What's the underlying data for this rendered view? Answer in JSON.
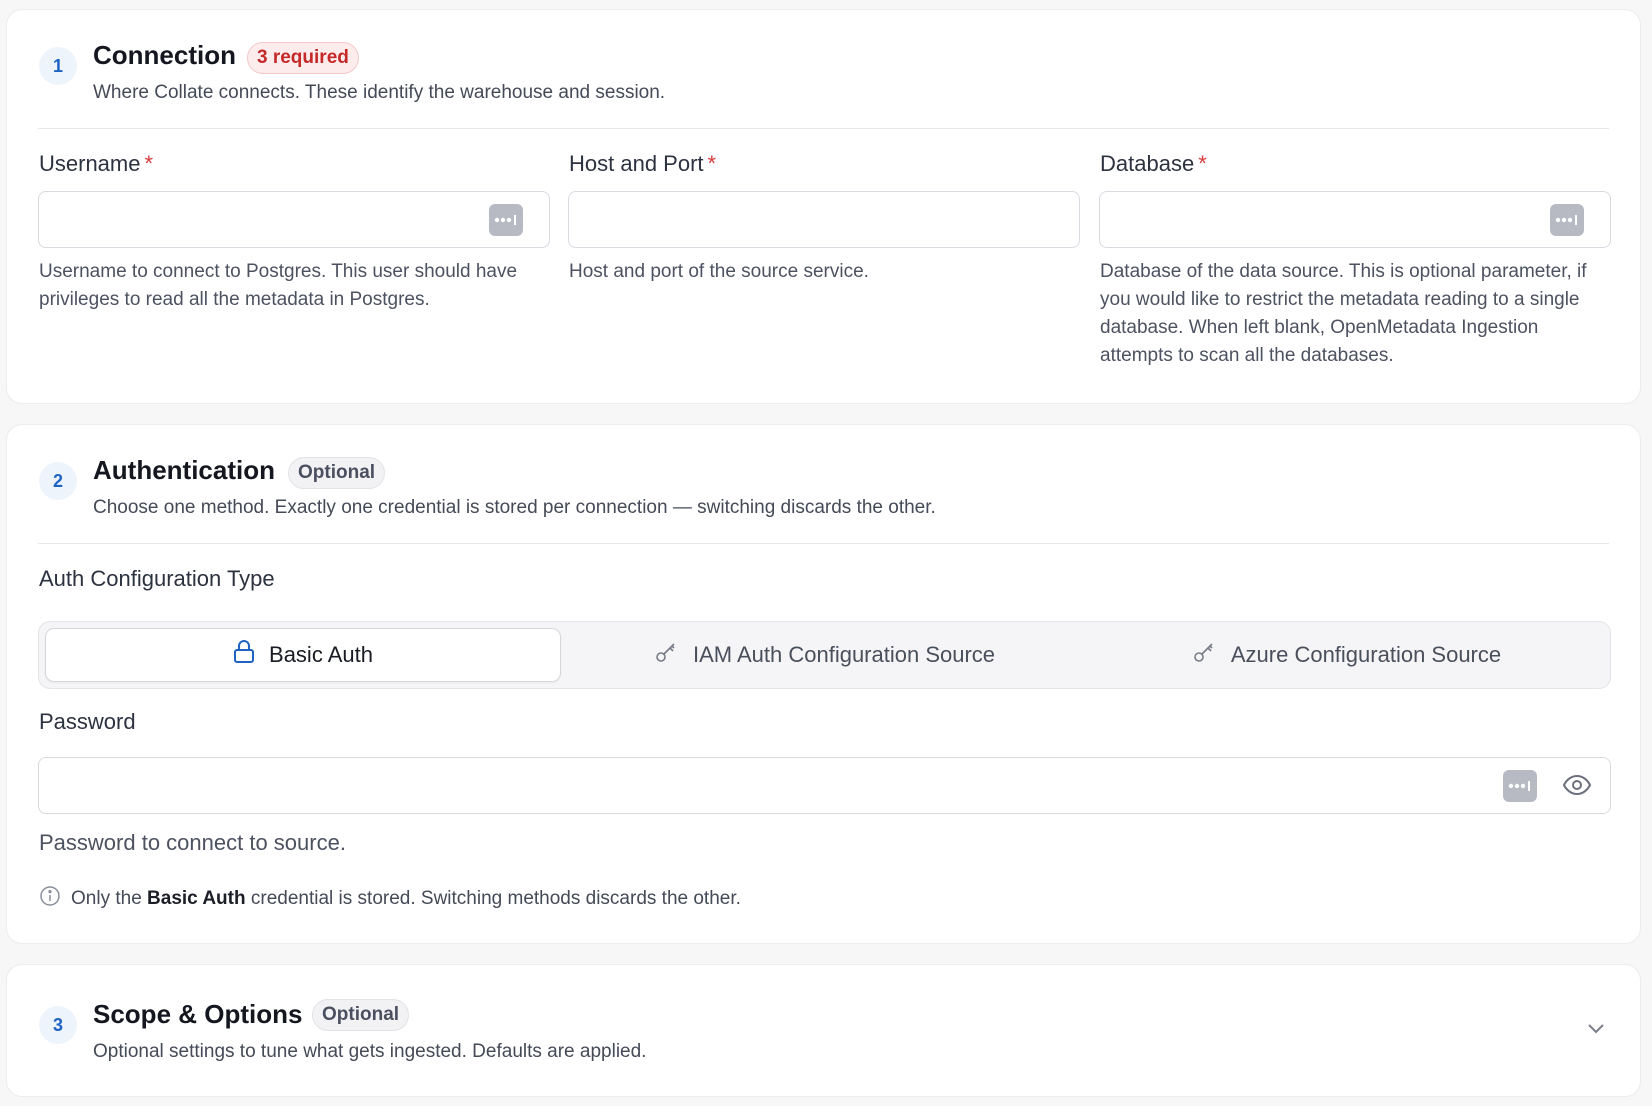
{
  "connection": {
    "step": "1",
    "title": "Connection",
    "badge": "3 required",
    "description": "Where Collate connects. These identify the warehouse and session.",
    "fields": [
      {
        "label": "Username",
        "required": "*",
        "value": "",
        "help": "Username to connect to Postgres. This user should have privileges to read all the metadata in Postgres."
      },
      {
        "label": "Host and Port",
        "required": "*",
        "value": "",
        "help": "Host and port of the source service."
      },
      {
        "label": "Database",
        "required": "*",
        "value": "",
        "help": "Database of the data source. This is optional parameter, if you would like to restrict the metadata reading to a single database. When left blank, OpenMetadata Ingestion attempts to scan all the databases."
      }
    ]
  },
  "authentication": {
    "step": "2",
    "title": "Authentication",
    "badge": "Optional",
    "description": "Choose one method. Exactly one credential is stored per connection — switching discards the other.",
    "auth_type_label": "Auth Configuration Type",
    "options": [
      {
        "label": "Basic Auth",
        "icon": "lock-icon",
        "selected": true
      },
      {
        "label": "IAM Auth Configuration Source",
        "icon": "key-icon",
        "selected": false
      },
      {
        "label": "Azure Configuration Source",
        "icon": "key-icon",
        "selected": false
      }
    ],
    "password": {
      "label": "Password",
      "value": "",
      "help": "Password to connect to source."
    },
    "note": {
      "prefix": "Only the",
      "strong": "Basic Auth",
      "suffix": "credential is stored. Switching methods discards the other."
    }
  },
  "scope": {
    "step": "3",
    "title": "Scope & Options",
    "badge": "Optional",
    "description": "Optional settings to tune what gets ingested. Defaults are applied."
  },
  "colors": {
    "accent": "#1e63c4",
    "required": "#d63b3b",
    "required_badge_bg": "#fdecec"
  }
}
